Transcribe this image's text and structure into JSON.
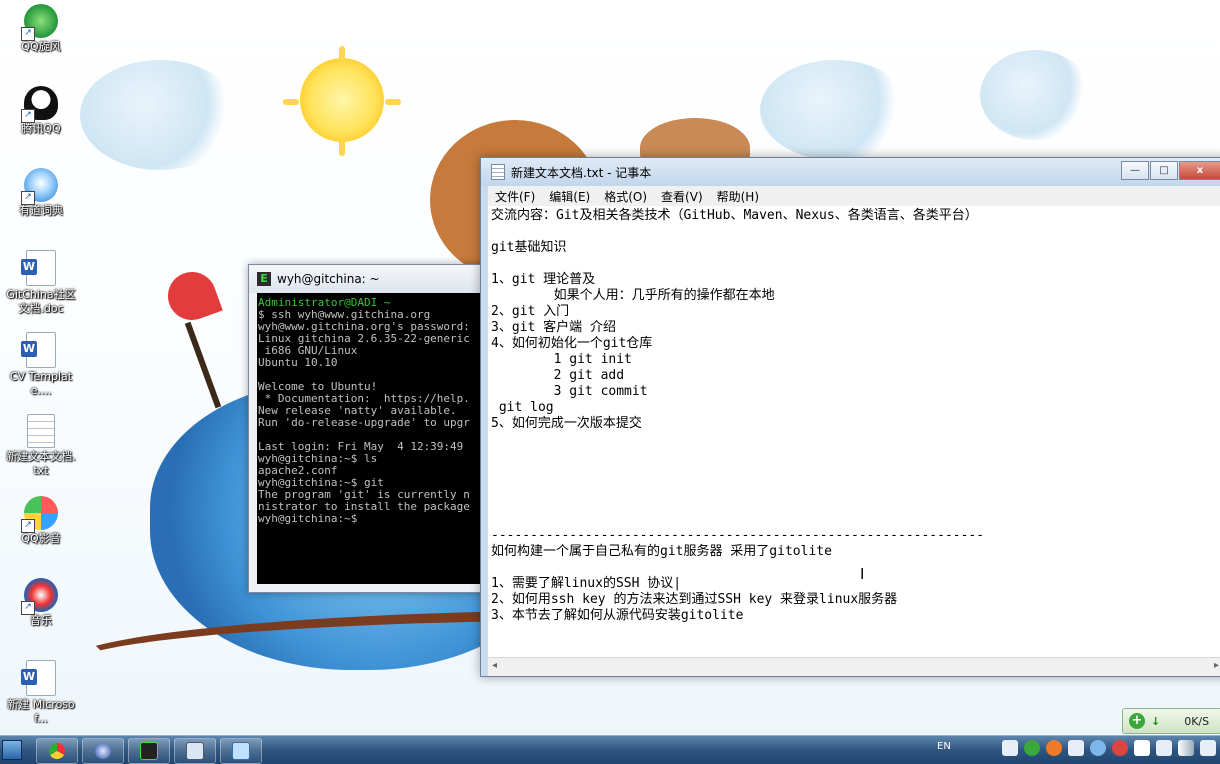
{
  "desktop": {
    "icons": [
      {
        "label": "QQ旋风",
        "icon": "qq-whirlwind-icon"
      },
      {
        "label": "腾讯QQ",
        "icon": "qq-penguin-icon"
      },
      {
        "label": "有道词典",
        "icon": "youdao-dict-icon"
      },
      {
        "label": "GitChina社区文档.doc",
        "icon": "word-doc-icon"
      },
      {
        "label": "CV Template....",
        "icon": "word-doc-icon"
      },
      {
        "label": "新建文本文档.txt",
        "icon": "text-file-icon"
      },
      {
        "label": "QQ影音",
        "icon": "qq-player-icon"
      },
      {
        "label": "音乐",
        "icon": "music-player-icon"
      },
      {
        "label": "新建 Microsof...",
        "icon": "word-doc-icon"
      }
    ]
  },
  "terminal": {
    "title": "wyh@gitchina: ~",
    "lines": [
      {
        "text": "Administrator@DADI ~",
        "color": "g"
      },
      {
        "text": "$ ssh wyh@www.gitchina.org",
        "color": ""
      },
      {
        "text": "wyh@www.gitchina.org's password:",
        "color": ""
      },
      {
        "text": "Linux gitchina 2.6.35-22-generic",
        "color": ""
      },
      {
        "text": " i686 GNU/Linux",
        "color": ""
      },
      {
        "text": "Ubuntu 10.10",
        "color": ""
      },
      {
        "text": "",
        "color": ""
      },
      {
        "text": "Welcome to Ubuntu!",
        "color": ""
      },
      {
        "text": " * Documentation:  https://help.",
        "color": ""
      },
      {
        "text": "New release 'natty' available.",
        "color": ""
      },
      {
        "text": "Run 'do-release-upgrade' to upgr",
        "color": ""
      },
      {
        "text": "",
        "color": ""
      },
      {
        "text": "Last login: Fri May  4 12:39:49",
        "color": ""
      },
      {
        "text": "wyh@gitchina:~$ ls",
        "color": ""
      },
      {
        "text": "apache2.conf",
        "color": ""
      },
      {
        "text": "wyh@gitchina:~$ git",
        "color": ""
      },
      {
        "text": "The program 'git' is currently n",
        "color": ""
      },
      {
        "text": "nistrator to install the package",
        "color": ""
      },
      {
        "text": "wyh@gitchina:~$ ",
        "color": ""
      }
    ]
  },
  "notepad": {
    "title": "新建文本文档.txt - 记事本",
    "menu": [
      "文件(F)",
      "编辑(E)",
      "格式(O)",
      "查看(V)",
      "帮助(H)"
    ],
    "controls": {
      "minimize": "—",
      "maximize": "□",
      "close": "x"
    },
    "lines": [
      "交流内容：Git及相关各类技术（GitHub、Maven、Nexus、各类语言、各类平台）",
      "",
      "git基础知识",
      "",
      "1、git 理论普及",
      "        如果个人用：几乎所有的操作都在本地",
      "2、git 入门",
      "3、git 客户端 介绍",
      "4、如何初始化一个git仓库",
      "        1 git init",
      "        2 git add",
      "        3 git commit",
      " git log",
      "5、如何完成一次版本提交",
      "",
      "",
      "",
      "",
      "",
      "",
      "---------------------------------------------------------------",
      "如何构建一个属于自己私有的git服务器 采用了gitolite",
      "",
      "1、需要了解linux的SSH 协议|",
      "2、如何用ssh key 的方法来达到通过SSH key 来登录linux服务器",
      "3、本节去了解如何从源代码安装gitolite"
    ]
  },
  "netwidget": {
    "speed": "0K/S"
  },
  "taskbar": {
    "lang": "EN"
  }
}
